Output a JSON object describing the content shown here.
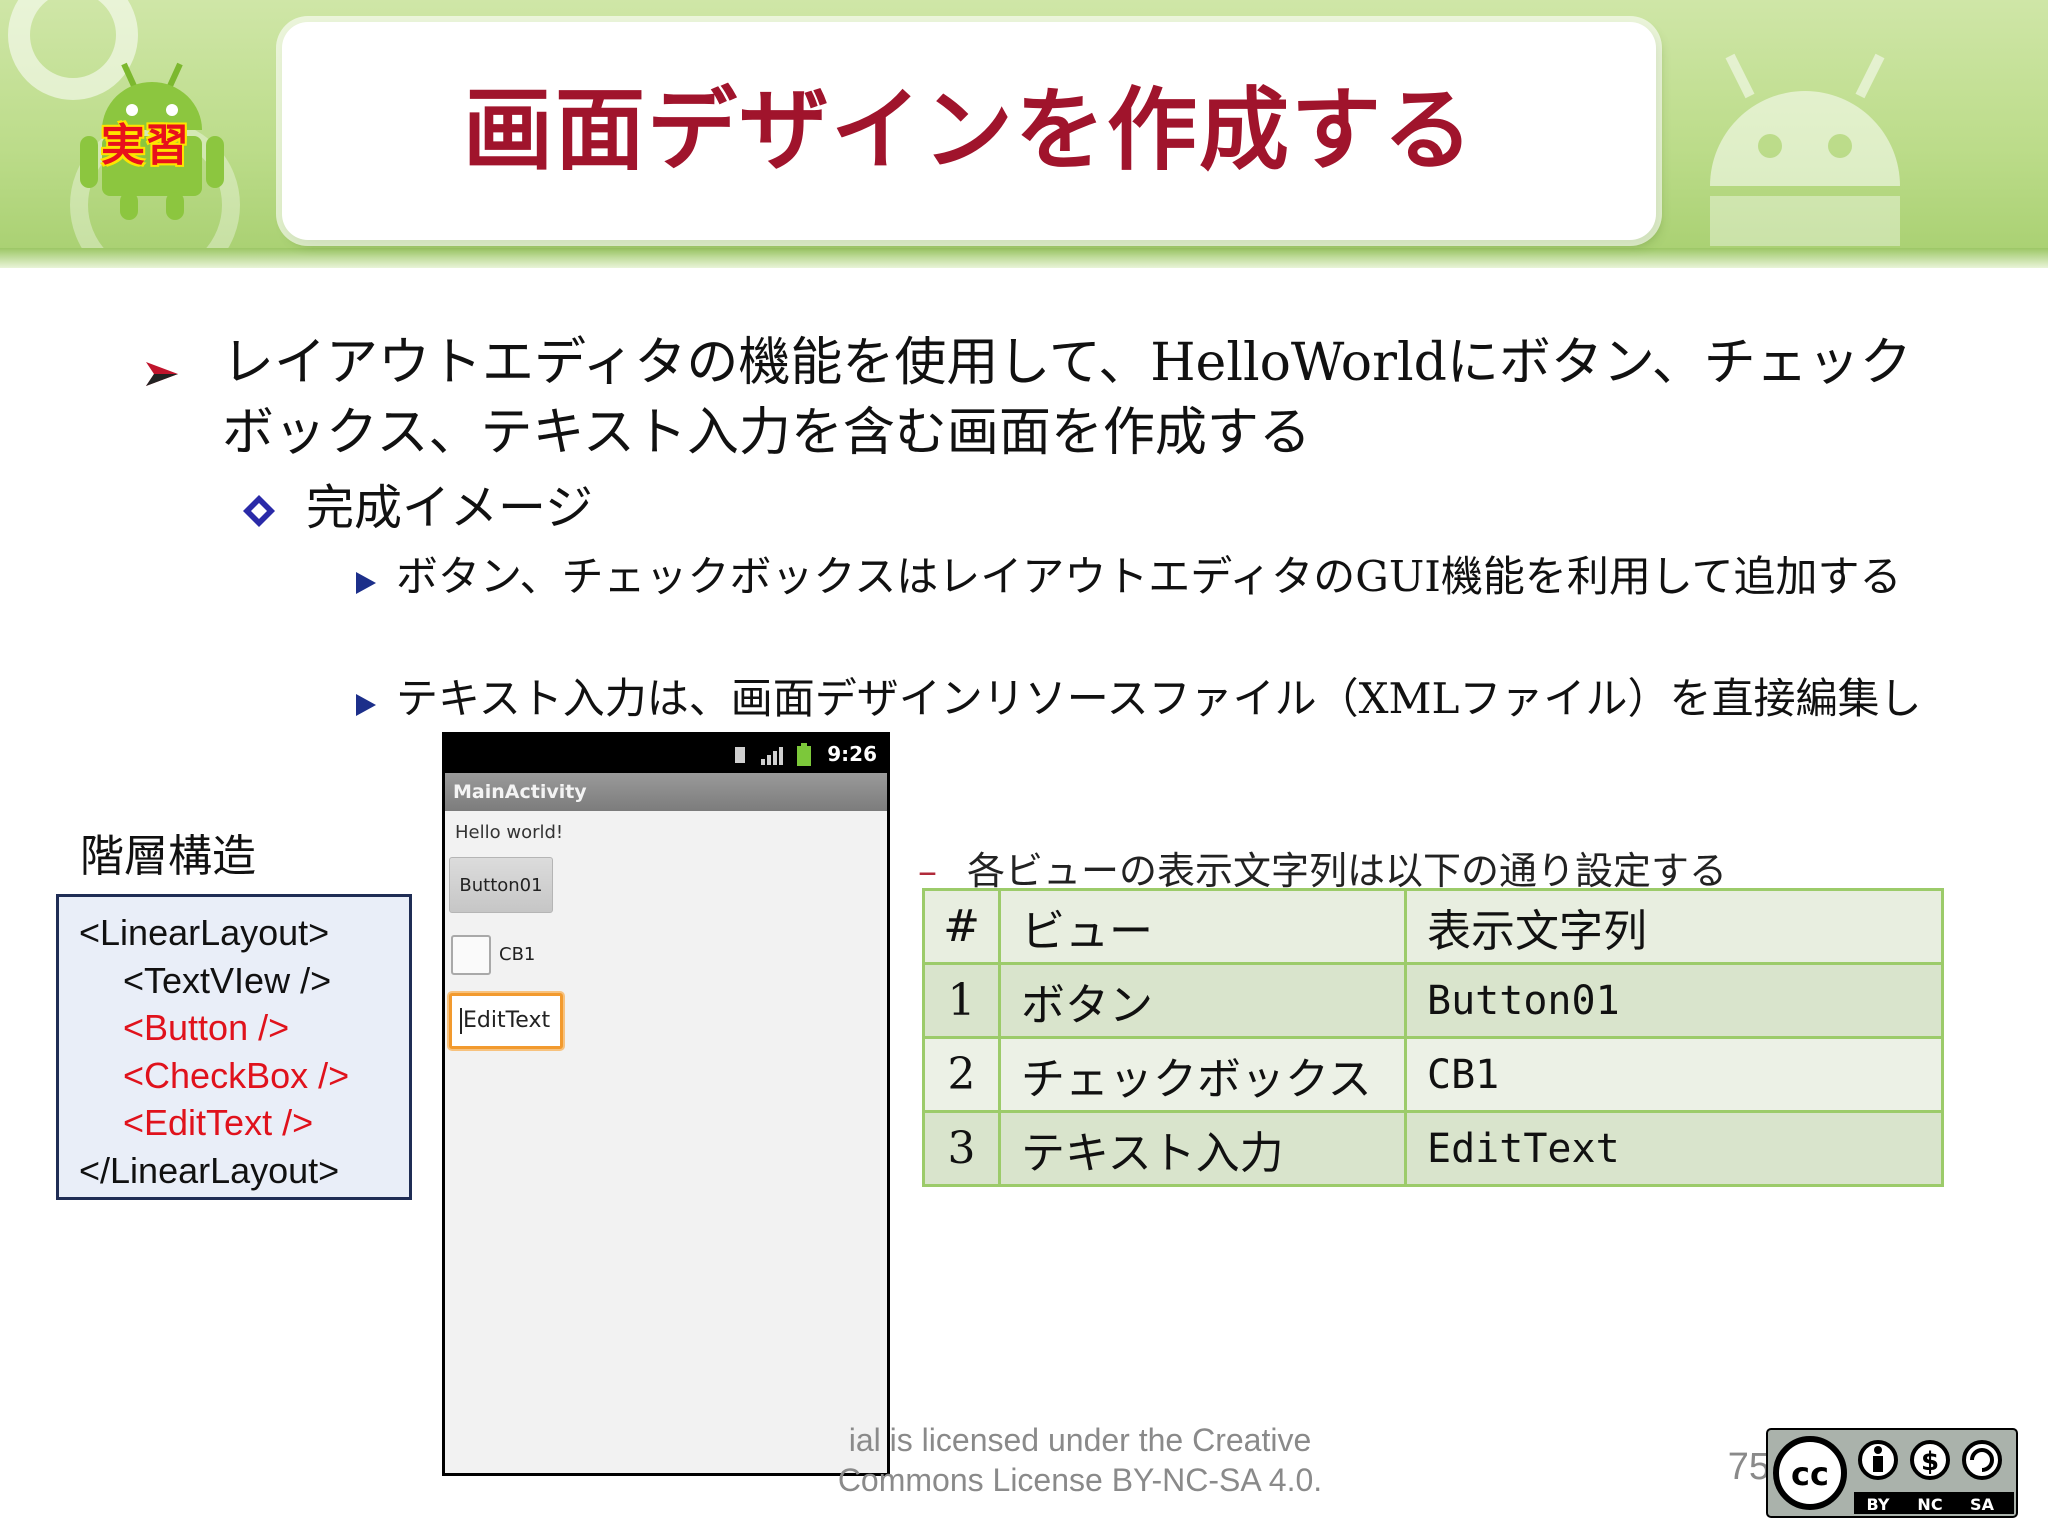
{
  "header": {
    "badge_label": "実習",
    "title": "画面デザインを作成する"
  },
  "bullets": {
    "main": "レイアウトエディタの機能を使用して、HelloWorldにボタン、チェックボックス、テキスト入力を含む画面を作成する",
    "sub": "完成イメージ",
    "items": [
      "ボタン、チェックボックスはレイアウトエディタのGUI機能を利用して追加する",
      "テキスト入力は、画面デザインリソースファイル（XMLファイル）を直接編集し"
    ]
  },
  "hierarchy": {
    "label": "階層構造",
    "lines": [
      "<LinearLayout>",
      "<TextVIew />",
      "<Button />",
      "<CheckBox />",
      "<EditText />",
      "</LinearLayout>"
    ]
  },
  "phone": {
    "time": "9:26",
    "app_title": "MainActivity",
    "hello_text": "Hello world!",
    "button_label": "Button01",
    "checkbox_label": "CB1",
    "edittext_value": "EditText"
  },
  "view_table": {
    "caption_marker": "–",
    "caption": "各ビューの表示文字列は以下の通り設定する",
    "headers": [
      "#",
      "ビュー",
      "表示文字列"
    ],
    "rows": [
      [
        "1",
        "ボタン",
        "Button01"
      ],
      [
        "2",
        "チェックボックス",
        "CB1"
      ],
      [
        "3",
        "テキスト入力",
        "EditText"
      ]
    ]
  },
  "footer": {
    "license_line1": "ial is licensed under the Creative",
    "license_line2": "Commons License BY-NC-SA 4.0.",
    "page_number": "75",
    "cc_labels": [
      "BY",
      "NC",
      "SA"
    ]
  },
  "colors": {
    "title": "#a0142c",
    "banner": "#bcdc8a",
    "table_border": "#9ccb6a",
    "hierarchy_highlight": "#e0121c"
  },
  "icons": {
    "main_bullet": "arrow-bullet-icon",
    "sub_bullet": "diamond-bullet-icon",
    "item_bullet": "triangle-bullet-icon"
  }
}
